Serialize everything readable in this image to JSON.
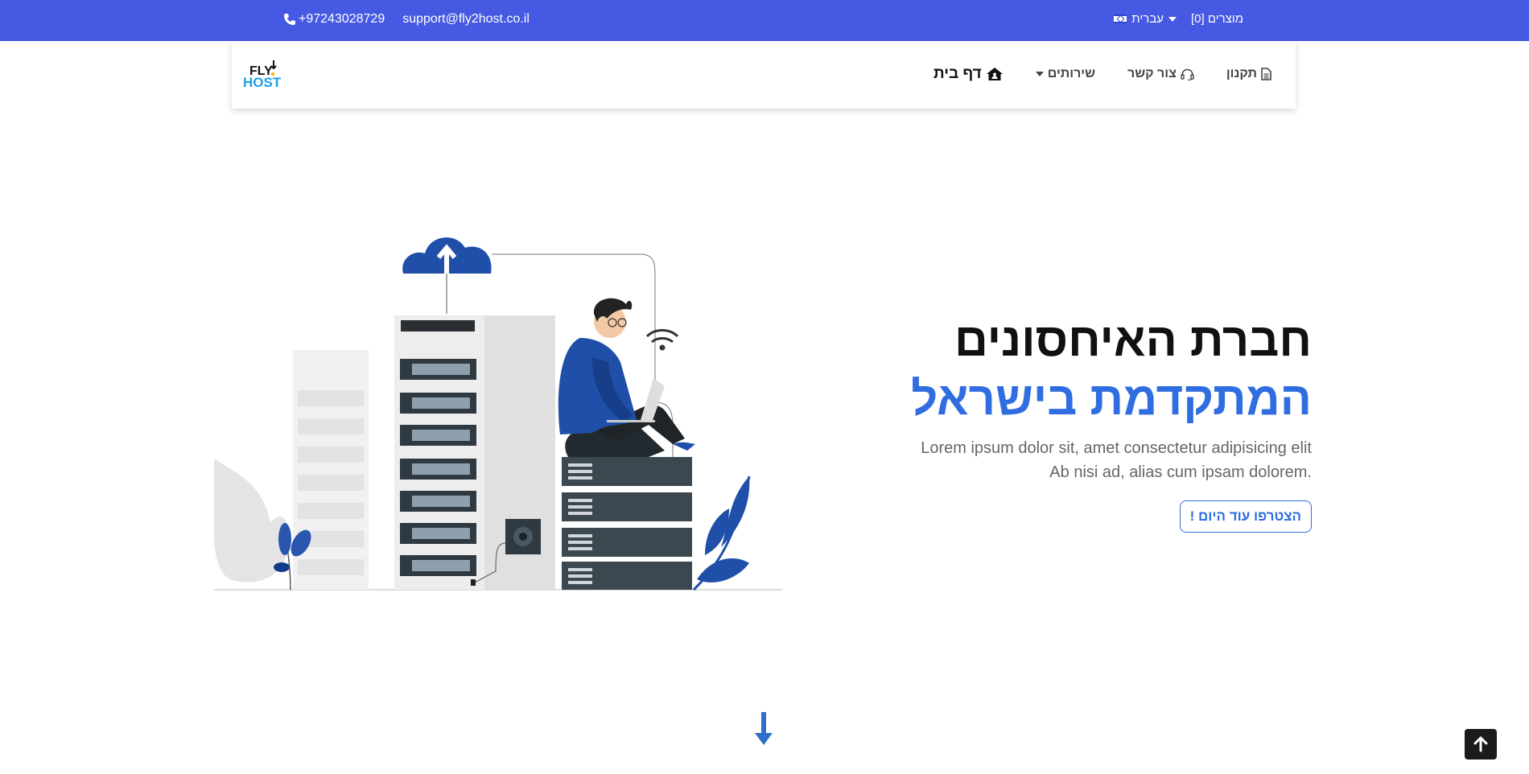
{
  "topbar": {
    "phone": "+97243028729",
    "email": "support@fly2host.co.il",
    "cart_label": "מוצרים [0]",
    "language_label": "עברית",
    "bg_color": "#4659e2"
  },
  "navbar": {
    "logo_text_top": "FLY",
    "logo_text_bottom": "HOST",
    "items": [
      {
        "label": "תקנון",
        "icon": "document-icon"
      },
      {
        "label": "צור קשר",
        "icon": "headset-icon"
      },
      {
        "label": "שירותים",
        "icon": "chevron-down-icon"
      },
      {
        "label": "דף בית",
        "icon": "home-icon"
      }
    ]
  },
  "hero": {
    "title_line1": "חברת האיחסונים",
    "title_line2": "המתקדמת בישראל",
    "lead_line1": "Lorem ipsum dolor sit, amet consectetur adipisicing elit",
    "lead_line2": "Ab nisi ad, alias cum ipsam dolorem.",
    "cta_label": "הצטרפו עוד היום !",
    "accent_color": "#2f6de0"
  }
}
